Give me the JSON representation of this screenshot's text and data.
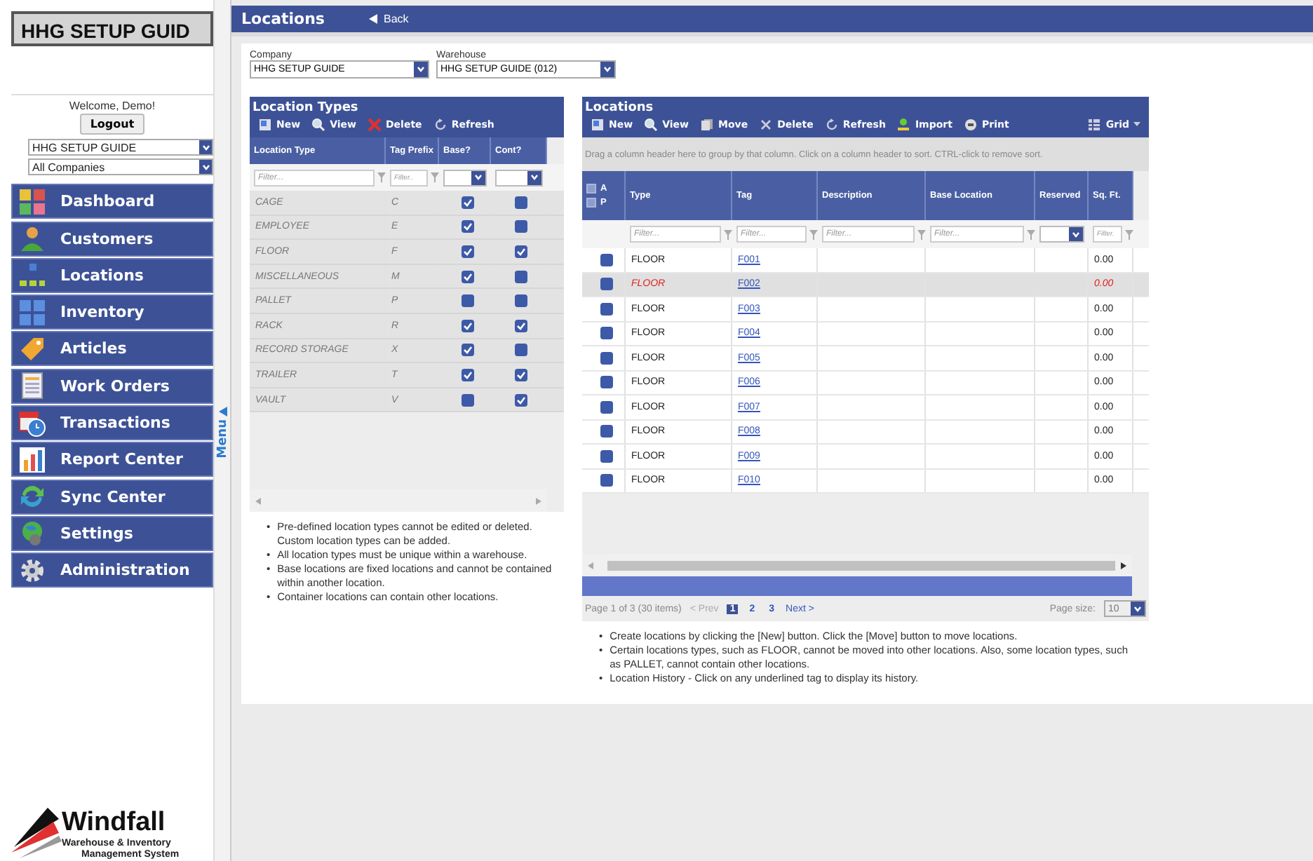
{
  "sidebar": {
    "title": "HHG SETUP GUID",
    "welcome": "Welcome, Demo!",
    "logout": "Logout",
    "selects": [
      "HHG SETUP GUIDE",
      "All Companies"
    ],
    "nav": [
      {
        "label": "Dashboard",
        "kind": "dashboard"
      },
      {
        "label": "Customers",
        "kind": "customers"
      },
      {
        "label": "Locations",
        "kind": "locations"
      },
      {
        "label": "Inventory",
        "kind": "inventory"
      },
      {
        "label": "Articles",
        "kind": "articles"
      },
      {
        "label": "Work Orders",
        "kind": "orders"
      },
      {
        "label": "Transactions",
        "kind": "transactions"
      },
      {
        "label": "Report Center",
        "kind": "report"
      },
      {
        "label": "Sync Center",
        "kind": "sync"
      },
      {
        "label": "Settings",
        "kind": "settings"
      },
      {
        "label": "Administration",
        "kind": "admin"
      }
    ],
    "menu_toggle": "Menu",
    "logo": {
      "name": "Windfall",
      "tagline": "Warehouse & Inventory",
      "tagline2": "Management System"
    }
  },
  "header": {
    "title": "Locations",
    "back": "Back"
  },
  "filters": [
    {
      "label": "Company",
      "value": "HHG SETUP GUIDE"
    },
    {
      "label": "Warehouse",
      "value": "HHG SETUP GUIDE (012)"
    }
  ],
  "location_types": {
    "title": "Location Types",
    "toolbar": [
      {
        "label": "New",
        "kind": "new"
      },
      {
        "label": "View",
        "kind": "view"
      },
      {
        "label": "Delete",
        "kind": "delete"
      },
      {
        "label": "Refresh",
        "kind": "refresh"
      }
    ],
    "columns": [
      {
        "label": "Location Type",
        "kind": "text",
        "placeholder": "Filter..."
      },
      {
        "label": "Tag Prefix",
        "kind": "text",
        "placeholder": "Filter.."
      },
      {
        "label": "Base?",
        "kind": "select"
      },
      {
        "label": "Cont?",
        "kind": "select"
      }
    ],
    "rows": [
      {
        "type": "CAGE",
        "prefix": "C",
        "base": true,
        "cont": false
      },
      {
        "type": "EMPLOYEE",
        "prefix": "E",
        "base": true,
        "cont": false
      },
      {
        "type": "FLOOR",
        "prefix": "F",
        "base": true,
        "cont": true
      },
      {
        "type": "MISCELLANEOUS",
        "prefix": "M",
        "base": true,
        "cont": false
      },
      {
        "type": "PALLET",
        "prefix": "P",
        "base": false,
        "cont": false
      },
      {
        "type": "RACK",
        "prefix": "R",
        "base": true,
        "cont": true
      },
      {
        "type": "RECORD STORAGE",
        "prefix": "X",
        "base": true,
        "cont": false
      },
      {
        "type": "TRAILER",
        "prefix": "T",
        "base": true,
        "cont": true
      },
      {
        "type": "VAULT",
        "prefix": "V",
        "base": false,
        "cont": true
      }
    ],
    "notes": [
      {
        "bullet": "•",
        "text": "Pre-defined location types cannot be edited or deleted. Custom location types can be added."
      },
      {
        "bullet": "•",
        "text": "All location types must be unique within a warehouse."
      },
      {
        "bullet": "•",
        "text": "Base locations are fixed locations and cannot be contained within another location."
      },
      {
        "bullet": "•",
        "text": "Container locations can contain other locations."
      }
    ]
  },
  "locations": {
    "title": "Locations",
    "toolbar": [
      {
        "label": "New",
        "kind": "new"
      },
      {
        "label": "View",
        "kind": "view"
      },
      {
        "label": "Move",
        "kind": "move"
      },
      {
        "label": "Delete",
        "kind": "delete-x"
      },
      {
        "label": "Refresh",
        "kind": "refresh"
      },
      {
        "label": "Import",
        "kind": "import"
      },
      {
        "label": "Print",
        "kind": "print"
      }
    ],
    "grid_menu": {
      "label": "Grid",
      "kind": "grid"
    },
    "group_hint": "Drag a column header here to group by that column. Click on a column header to sort. CTRL-click to remove sort.",
    "header_checks": [
      {
        "label": "A",
        "checked": false
      },
      {
        "label": "P",
        "checked": false
      }
    ],
    "columns": [
      {
        "label": "Type",
        "kind": "text",
        "placeholder": "Filter..."
      },
      {
        "label": "Tag",
        "kind": "text",
        "placeholder": "Filter..."
      },
      {
        "label": "Description",
        "kind": "text",
        "placeholder": "Filter..."
      },
      {
        "label": "Base Location",
        "kind": "text",
        "placeholder": "Filter..."
      },
      {
        "label": "Reserved",
        "kind": "select"
      },
      {
        "label": "Sq. Ft.",
        "kind": "text",
        "placeholder": "Filter."
      }
    ],
    "rows": [
      {
        "checked": false,
        "selected": false,
        "type": "FLOOR",
        "tag": "F001",
        "sqft": "0.00"
      },
      {
        "checked": false,
        "selected": true,
        "type": "FLOOR",
        "tag": "F002",
        "sqft": "0.00"
      },
      {
        "checked": false,
        "selected": false,
        "type": "FLOOR",
        "tag": "F003",
        "sqft": "0.00"
      },
      {
        "checked": false,
        "selected": false,
        "type": "FLOOR",
        "tag": "F004",
        "sqft": "0.00"
      },
      {
        "checked": false,
        "selected": false,
        "type": "FLOOR",
        "tag": "F005",
        "sqft": "0.00"
      },
      {
        "checked": false,
        "selected": false,
        "type": "FLOOR",
        "tag": "F006",
        "sqft": "0.00"
      },
      {
        "checked": false,
        "selected": false,
        "type": "FLOOR",
        "tag": "F007",
        "sqft": "0.00"
      },
      {
        "checked": false,
        "selected": false,
        "type": "FLOOR",
        "tag": "F008",
        "sqft": "0.00"
      },
      {
        "checked": false,
        "selected": false,
        "type": "FLOOR",
        "tag": "F009",
        "sqft": "0.00"
      },
      {
        "checked": false,
        "selected": false,
        "type": "FLOOR",
        "tag": "F010",
        "sqft": "0.00"
      }
    ],
    "pager": {
      "summary": "Page 1 of 3 (30 items)",
      "prev": "< Prev",
      "pages": [
        {
          "label": "1",
          "selected": true
        },
        {
          "label": "2",
          "selected": false
        },
        {
          "label": "3",
          "selected": false
        }
      ],
      "next": "Next >",
      "size_label": "Page size:",
      "size": "10"
    },
    "notes": [
      {
        "bullet": "•",
        "text": "Create locations by clicking the [New] button. Click the [Move] button to move locations."
      },
      {
        "bullet": "•",
        "text": "Certain locations types, such as FLOOR, cannot be moved into other locations. Also, some location types, such as PALLET, cannot contain other locations."
      },
      {
        "bullet": "•",
        "text": "Location History - Click on any underlined tag to display its history."
      }
    ]
  }
}
